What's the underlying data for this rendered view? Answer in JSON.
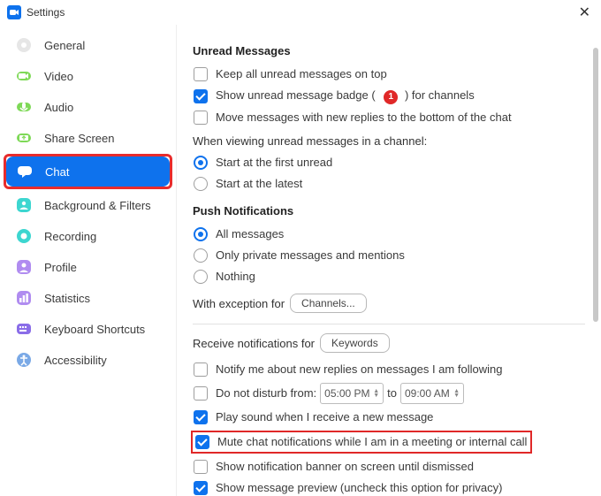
{
  "title": "Settings",
  "sidebar": {
    "items": [
      {
        "label": "General"
      },
      {
        "label": "Video"
      },
      {
        "label": "Audio"
      },
      {
        "label": "Share Screen"
      },
      {
        "label": "Chat"
      },
      {
        "label": "Background & Filters"
      },
      {
        "label": "Recording"
      },
      {
        "label": "Profile"
      },
      {
        "label": "Statistics"
      },
      {
        "label": "Keyboard Shortcuts"
      },
      {
        "label": "Accessibility"
      }
    ]
  },
  "unread": {
    "title": "Unread Messages",
    "keep_top": "Keep all unread messages on top",
    "badge_prefix": "Show unread message badge (",
    "badge_count": "1",
    "badge_suffix": ") for channels",
    "move_bottom": "Move messages with new replies to the bottom of the chat",
    "viewing_label": "When viewing unread messages in a channel:",
    "start_first": "Start at the first unread",
    "start_latest": "Start at the latest"
  },
  "push": {
    "title": "Push Notifications",
    "all": "All messages",
    "private": "Only private messages and mentions",
    "nothing": "Nothing",
    "exception_label": "With exception for",
    "exception_btn": "Channels..."
  },
  "receive": {
    "label": "Receive notifications for",
    "btn": "Keywords",
    "notify_following": "Notify me about new replies on messages I am following",
    "dnd_label": "Do not disturb from:",
    "dnd_from": "05:00 PM",
    "dnd_to_label": "to",
    "dnd_to": "09:00 AM",
    "play_sound": "Play sound when I receive a new message",
    "mute_meeting": "Mute chat notifications while I am in a meeting or internal call",
    "show_banner": "Show notification banner on screen until dismissed",
    "show_preview": "Show message preview (uncheck this option for privacy)"
  }
}
